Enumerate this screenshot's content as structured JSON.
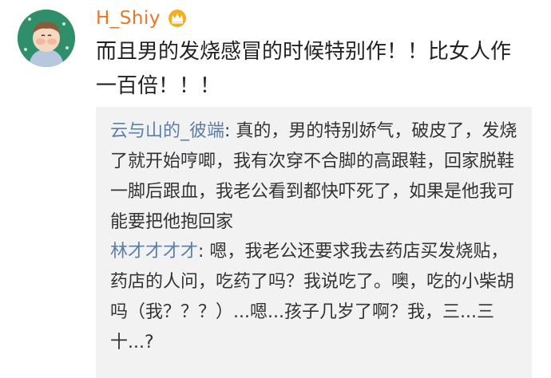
{
  "comment": {
    "username": "H_Shiy",
    "text": "而且男的发烧感冒的时候特别作！！比女人作一百倍！！！"
  },
  "replies": [
    {
      "user": "云与山的_彼端",
      "separator": ": ",
      "text": "真的，男的特别娇气，破皮了，发烧了就开始哼唧，我有次穿不合脚的高跟鞋，回家脱鞋一脚后跟血，我老公看到都快吓死了，如果是他我可能要把他抱回家"
    },
    {
      "user": "林才才才才",
      "separator": ": ",
      "text": "嗯，我老公还要求我去药店买发烧贴，药店的人问，吃药了吗？我说吃了。噢，吃的小柴胡吗（我？？？）...嗯...孩子几岁了啊？我，三...三十...?"
    }
  ],
  "colors": {
    "username": "#e8772a",
    "reply_user": "#5a7fa8",
    "reply_background": "#f2f2f2",
    "avatar_background": "#2f8f6a",
    "crown": "#f2b01e"
  },
  "icons": {
    "avatar": "baby-avatar-icon",
    "badge": "crown-icon"
  }
}
